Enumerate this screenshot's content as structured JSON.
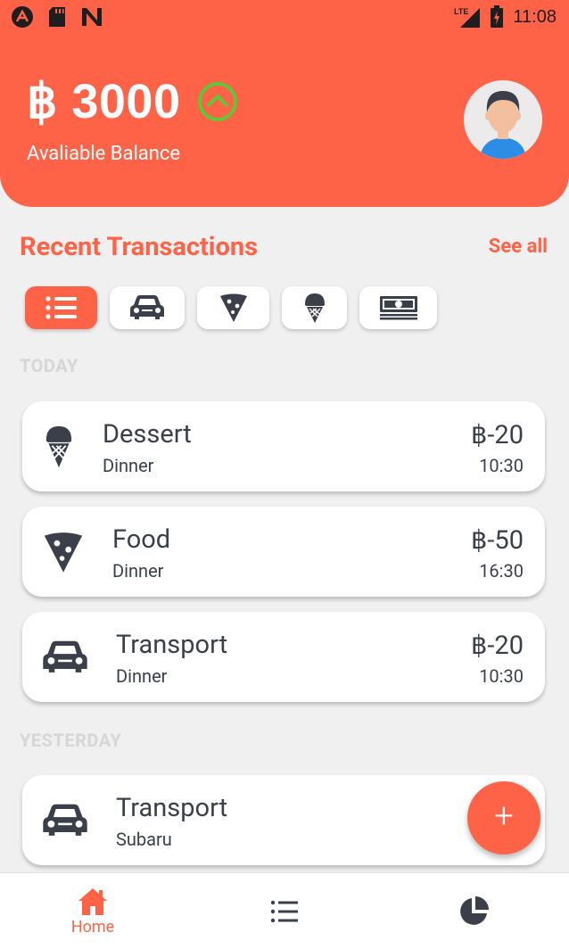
{
  "status_bar": {
    "time": "11:08",
    "network": "LTE"
  },
  "header": {
    "balance": "฿ 3000",
    "balance_label": "Avaliable Balance"
  },
  "recent": {
    "title": "Recent Transactions",
    "see_all": "See all"
  },
  "filters": [
    {
      "icon": "list-icon",
      "active": true
    },
    {
      "icon": "car-icon",
      "active": false
    },
    {
      "icon": "pizza-icon",
      "active": false
    },
    {
      "icon": "ice-cream-icon",
      "active": false
    },
    {
      "icon": "money-icon",
      "active": false
    }
  ],
  "groups": {
    "today": "TODAY",
    "yesterday": "YESTERDAY"
  },
  "transactions": [
    {
      "icon": "ice-cream-icon",
      "title": "Dessert",
      "sub": "Dinner",
      "amount": "฿-20",
      "time": "10:30"
    },
    {
      "icon": "pizza-icon",
      "title": "Food",
      "sub": "Dinner",
      "amount": "฿-50",
      "time": "16:30"
    },
    {
      "icon": "car-icon",
      "title": "Transport",
      "sub": "Dinner",
      "amount": "฿-20",
      "time": "10:30"
    },
    {
      "icon": "car-icon",
      "title": "Transport",
      "sub": "Subaru"
    }
  ],
  "fab": {
    "label": "+"
  },
  "nav": {
    "home": "Home"
  },
  "colors": {
    "accent": "#ff6347",
    "text": "#3a3f4a",
    "up_indicator": "#4cd137",
    "muted": "#d6d6d6"
  }
}
